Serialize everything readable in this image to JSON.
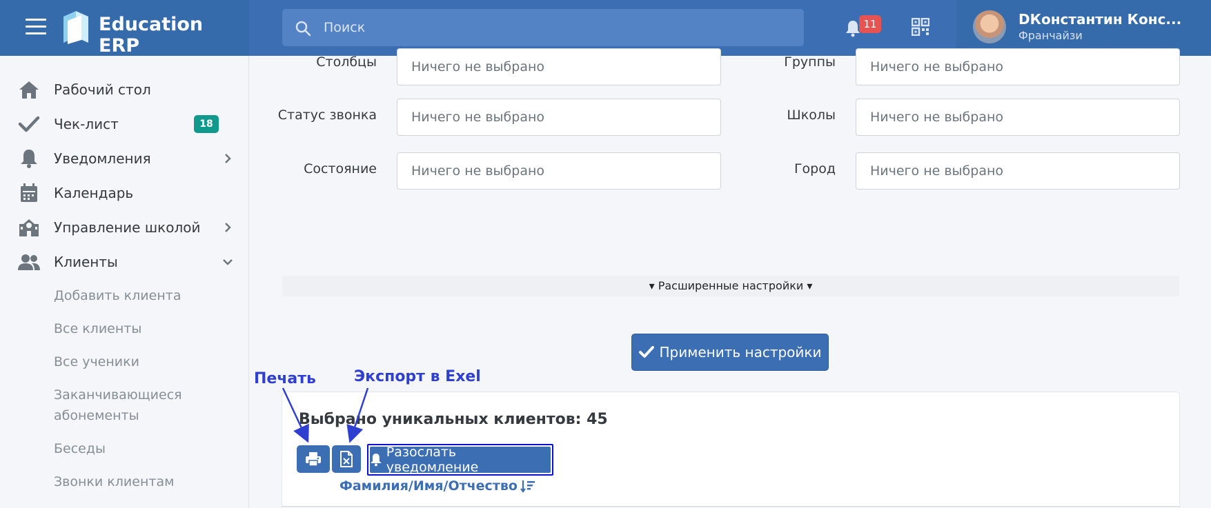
{
  "header": {
    "brand": "Education ERP",
    "search_placeholder": "Поиск",
    "notifications_count": "11",
    "user_name": "DКонстантин Конс...",
    "user_role": "Франчайзи"
  },
  "sidebar": {
    "items": [
      {
        "label": "Рабочий стол",
        "icon": "home-icon"
      },
      {
        "label": "Чек-лист",
        "icon": "check-icon",
        "badge": "18"
      },
      {
        "label": "Уведомления",
        "icon": "bell-icon"
      },
      {
        "label": "Календарь",
        "icon": "calendar-icon"
      },
      {
        "label": "Управление школой",
        "icon": "school-icon"
      },
      {
        "label": "Клиенты",
        "icon": "users-icon"
      }
    ],
    "sub_items": [
      "Добавить клиента",
      "Все клиенты",
      "Все ученики",
      "Заканчивающиеся абонементы",
      "Беседы",
      "Звонки клиентам"
    ]
  },
  "filters": {
    "placeholder": "Ничего не выбрано",
    "left": [
      "Столбцы",
      "Статус звонка",
      "Состояние"
    ],
    "right": [
      "Группы",
      "Школы",
      "Город"
    ]
  },
  "advanced_settings": "Расширенные настройки",
  "apply_button": "Применить настройки",
  "results": {
    "count_label": "Выбрано уникальных клиентов: 45",
    "notify_button": "Разослать уведомление",
    "sort_column": "Фамилия/Имя/Отчество"
  },
  "annotations": {
    "print": "Печать",
    "export": "Экспорт в Exel"
  },
  "colors": {
    "primary": "#3c6eb4",
    "badge_green": "#11998e",
    "badge_red": "#e55353",
    "annotation": "#2f3fd0"
  }
}
